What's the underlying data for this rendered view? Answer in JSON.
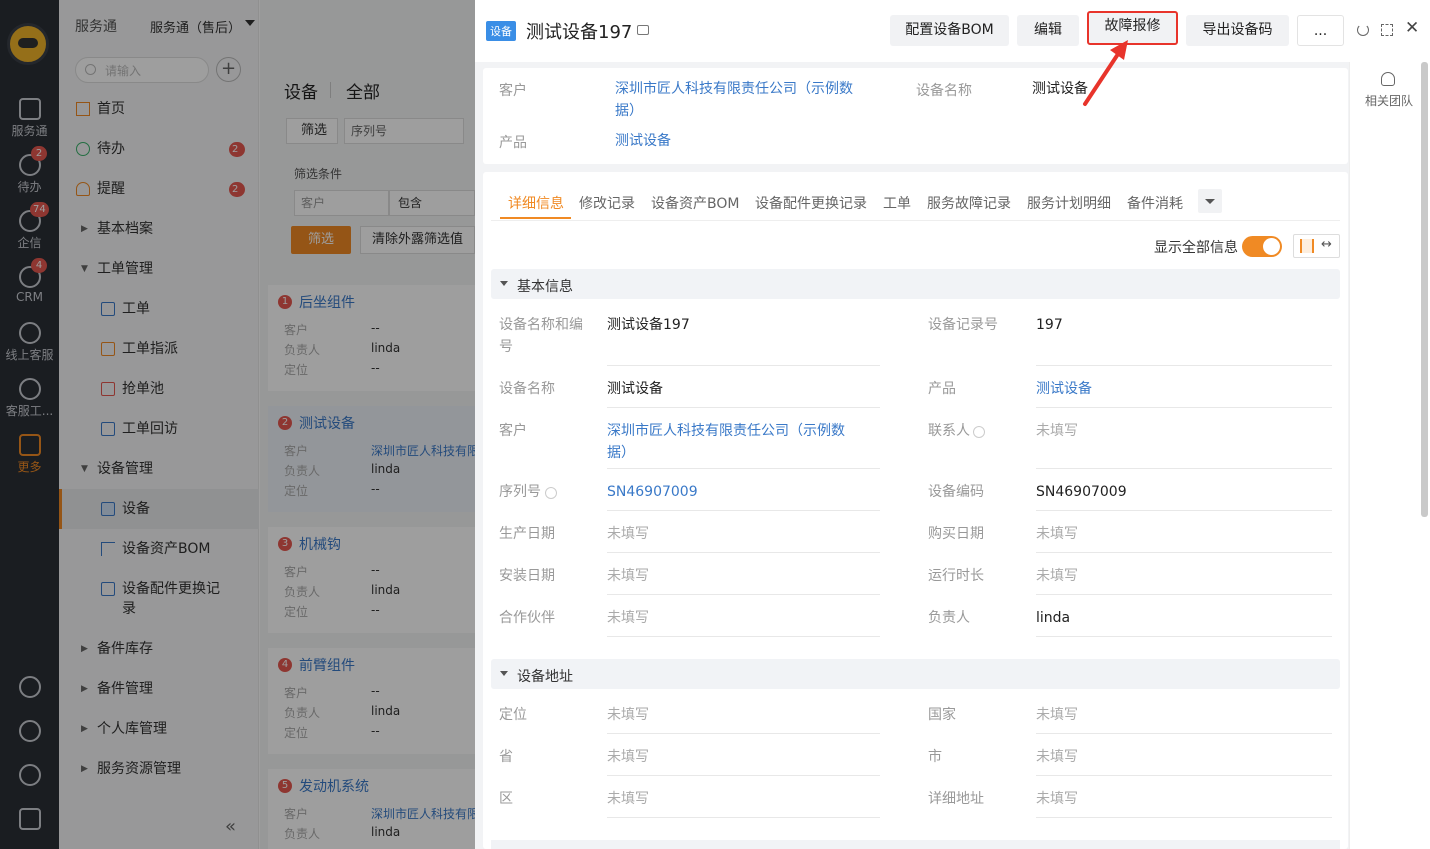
{
  "rail": {
    "items": [
      {
        "label": "服务通"
      },
      {
        "label": "待办",
        "badge": "2"
      },
      {
        "label": "企信",
        "badge": "74"
      },
      {
        "label": "CRM",
        "badge": "4"
      },
      {
        "label": "线上客服"
      },
      {
        "label": "客服工..."
      },
      {
        "label": "更多"
      }
    ]
  },
  "nav": {
    "breadcrumb_app": "服务通",
    "breadcrumb_module": "服务通（售后）",
    "search_placeholder": "请输入",
    "items": [
      {
        "label": "首页"
      },
      {
        "label": "待办",
        "badge": "2"
      },
      {
        "label": "提醒",
        "badge": "2"
      },
      {
        "label": "基本档案"
      },
      {
        "label": "工单管理"
      },
      {
        "label": "工单"
      },
      {
        "label": "工单指派"
      },
      {
        "label": "抢单池"
      },
      {
        "label": "工单回访"
      },
      {
        "label": "设备管理"
      },
      {
        "label": "设备"
      },
      {
        "label": "设备资产BOM"
      },
      {
        "label": "设备配件更换记录"
      },
      {
        "label": "备件库存"
      },
      {
        "label": "备件管理"
      },
      {
        "label": "个人库管理"
      },
      {
        "label": "服务资源管理"
      }
    ],
    "collapse_label": "«"
  },
  "list": {
    "title": "设备",
    "scope": "全部",
    "filter_label": "筛选",
    "serial_select": "序列号",
    "conditions_label": "筛选条件",
    "cond_field": "客户",
    "cond_op": "包含",
    "filter_btn": "筛选",
    "clear_btn": "清除外露筛选值",
    "cards": [
      {
        "num": "1",
        "title": "后坐组件",
        "customer": "--",
        "owner": "linda",
        "location": "--"
      },
      {
        "num": "2",
        "title": "测试设备",
        "customer": "深圳市匠人科技有限",
        "owner": "linda",
        "location": "--"
      },
      {
        "num": "3",
        "title": "机械钩",
        "customer": "--",
        "owner": "linda",
        "location": "--"
      },
      {
        "num": "4",
        "title": "前臂组件",
        "customer": "--",
        "owner": "linda",
        "location": "--"
      },
      {
        "num": "5",
        "title": "发动机系统",
        "customer": "深圳市匠人科技有限",
        "owner": "linda",
        "location": ""
      }
    ],
    "k_customer": "客户",
    "k_owner": "负责人",
    "k_location": "定位"
  },
  "drawer": {
    "tag": "设备",
    "title": "测试设备197",
    "buttons": {
      "bom": "配置设备BOM",
      "edit": "编辑",
      "report": "故障报修",
      "export": "导出设备码",
      "more": "..."
    },
    "summary": {
      "customer_label": "客户",
      "customer_value": "深圳市匠人科技有限责任公司（示例数据）",
      "name_label": "设备名称",
      "name_value": "测试设备",
      "product_label": "产品",
      "product_value": "测试设备"
    },
    "tabs": [
      "详细信息",
      "修改记录",
      "设备资产BOM",
      "设备配件更换记录",
      "工单",
      "服务故障记录",
      "服务计划明细",
      "备件消耗"
    ],
    "show_all_label": "显示全部信息",
    "basic_title": "基本信息",
    "fields": {
      "f1l": "设备名称和编号",
      "f1v": "测试设备197",
      "f2l": "设备记录号",
      "f2v": "197",
      "f3l": "设备名称",
      "f3v": "测试设备",
      "f4l": "产品",
      "f4v": "测试设备",
      "f5l": "客户",
      "f5v": "深圳市匠人科技有限责任公司（示例数据）",
      "f6l": "联系人",
      "f6v": "未填写",
      "f7l": "序列号",
      "f7v": "SN46907009",
      "f8l": "设备编码",
      "f8v": "SN46907009",
      "f9l": "生产日期",
      "f9v": "未填写",
      "f10l": "购买日期",
      "f10v": "未填写",
      "f11l": "安装日期",
      "f11v": "未填写",
      "f12l": "运行时长",
      "f12v": "未填写",
      "f13l": "合作伙伴",
      "f13v": "未填写",
      "f14l": "负责人",
      "f14v": "linda"
    },
    "address_title": "设备地址",
    "address": {
      "a1l": "定位",
      "a1v": "未填写",
      "a2l": "国家",
      "a2v": "未填写",
      "a3l": "省",
      "a3v": "未填写",
      "a4l": "市",
      "a4v": "未填写",
      "a5l": "区",
      "a5v": "未填写",
      "a6l": "详细地址",
      "a6v": "未填写"
    },
    "side_team": "相关团队"
  },
  "colors": {
    "accent": "#f08a24",
    "link": "#3a79c8",
    "highlight": "#e8342b"
  }
}
